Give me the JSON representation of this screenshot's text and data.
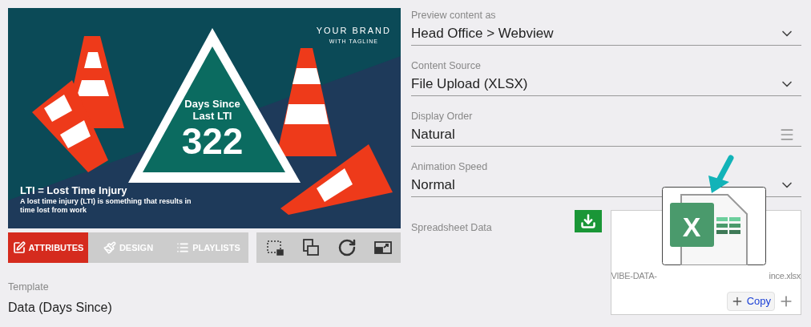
{
  "preview": {
    "brand": "YOUR BRAND",
    "tagline": "WITH TAGLINE",
    "sign_heading": "Days Since\nLast LTI",
    "sign_count": "322",
    "caption_title": "LTI = Lost Time Injury",
    "caption_text": "A lost time injury (LTI) is something that results in time lost from work"
  },
  "tabs": [
    {
      "label": "ATTRIBUTES",
      "kind": "edit",
      "selected": true
    },
    {
      "label": "DESIGN",
      "kind": "brush",
      "selected": false
    },
    {
      "label": "PLAYLISTS",
      "kind": "list",
      "selected": false
    }
  ],
  "toolbar": [
    {
      "kind": "capture"
    },
    {
      "kind": "layers"
    },
    {
      "kind": "refresh"
    },
    {
      "kind": "popout"
    }
  ],
  "template": {
    "label": "Template",
    "value": "Data (Days Since)"
  },
  "fields": [
    {
      "label": "Preview content as",
      "value": "Head Office > Webview",
      "kind": "dropdown"
    },
    {
      "label": "Content Source",
      "value": "File Upload (XLSX)",
      "kind": "dropdown"
    },
    {
      "label": "Display Order",
      "value": "Natural",
      "kind": "sort"
    },
    {
      "label": "Animation Speed",
      "value": "Normal",
      "kind": "dropdown"
    }
  ],
  "spreadsheet": {
    "label": "Spreadsheet Data",
    "file_name_start": "VIBE-DATA-",
    "file_name_end": "ince.xlsx",
    "copy_label": "Copy",
    "file_icon_letter": "X"
  }
}
